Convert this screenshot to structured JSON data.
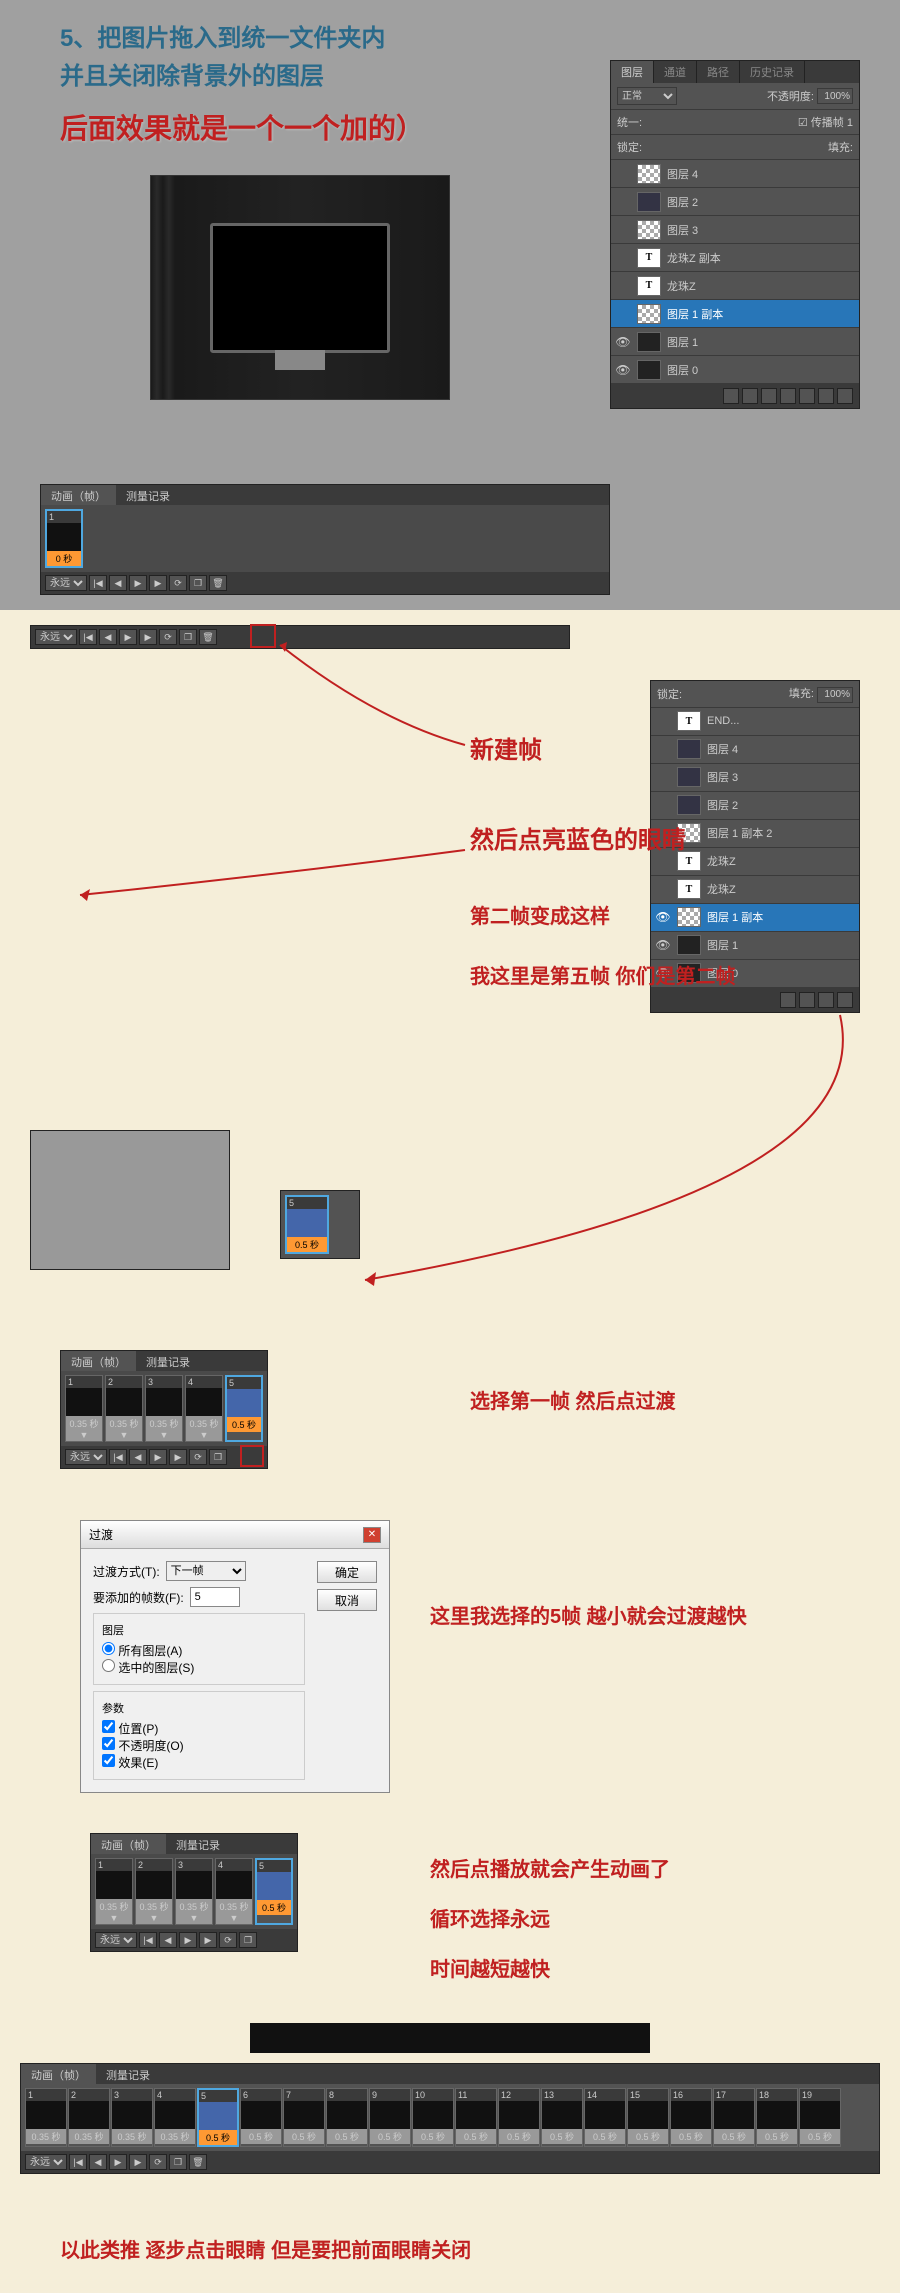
{
  "top": {
    "line1": "5、把图片拖入到统一文件夹内",
    "line2": "并且关闭除背景外的图层",
    "line3": "后面效果就是一个一个加的）"
  },
  "layersPanel1": {
    "tabs": [
      "图层",
      "通道",
      "路径",
      "历史记录"
    ],
    "mode": "正常",
    "opacityLabel": "不透明度:",
    "opacity": "100%",
    "lockLabel": "统一:",
    "fillLabel": "传播帧 1",
    "lockRow": "锁定:",
    "fillPct": "填充:",
    "layers": [
      {
        "eye": false,
        "thumb": "checker",
        "name": "图层 4"
      },
      {
        "eye": false,
        "thumb": "img",
        "name": "图层 2"
      },
      {
        "eye": false,
        "thumb": "checker",
        "name": "图层 3"
      },
      {
        "eye": false,
        "thumb": "text",
        "t": "T",
        "name": "龙珠Z 副本"
      },
      {
        "eye": false,
        "thumb": "text",
        "t": "T",
        "name": "龙珠Z"
      },
      {
        "eye": false,
        "thumb": "checker",
        "name": "图层 1 副本",
        "selected": true
      },
      {
        "eye": true,
        "thumb": "dark",
        "name": "图层 1"
      },
      {
        "eye": true,
        "thumb": "dark",
        "name": "图层 0"
      }
    ]
  },
  "timeline1": {
    "tabs": [
      "动画（帧）",
      "测量记录"
    ],
    "loop": "永远",
    "frame": {
      "num": "1",
      "time": "0 秒"
    }
  },
  "layersPanel2": {
    "lockLabel": "锁定:",
    "fillLabel": "填充:",
    "fillValue": "100%",
    "layers": [
      {
        "eye": false,
        "thumb": "text",
        "t": "T",
        "name": "END..."
      },
      {
        "eye": false,
        "thumb": "img",
        "name": "图层 4"
      },
      {
        "eye": false,
        "thumb": "img",
        "name": "图层 3"
      },
      {
        "eye": false,
        "thumb": "img",
        "name": "图层 2"
      },
      {
        "eye": false,
        "thumb": "checker",
        "name": "图层 1 副本 2"
      },
      {
        "eye": false,
        "thumb": "text",
        "t": "T",
        "name": "龙珠Z"
      },
      {
        "eye": false,
        "thumb": "text",
        "t": "T",
        "name": "龙珠Z"
      },
      {
        "eye": true,
        "thumb": "checker",
        "name": "图层 1 副本",
        "selected": true
      },
      {
        "eye": true,
        "thumb": "dark",
        "name": "图层 1"
      },
      {
        "eye": true,
        "thumb": "dark",
        "name": "图层 0"
      }
    ]
  },
  "annotations": {
    "a1": "新建帧",
    "a2": "然后点亮蓝色的眼睛",
    "a3": "第二帧变成这样",
    "a4": "我这里是第五帧 你们是第二帧",
    "a5": "选择第一帧  然后点过渡",
    "a6": "这里我选择的5帧   越小就会过渡越快",
    "a7": "然后点播放就会产生动画了",
    "a8": "循环选择永远",
    "a9": "时间越短越快",
    "final": "以此类推 逐步点击眼睛 但是要把前面眼睛关闭"
  },
  "snippet5": {
    "num": "5",
    "time": "0.5 秒"
  },
  "timeline5": {
    "tabs": [
      "动画（帧）",
      "测量记录"
    ],
    "loop": "永远",
    "frames": [
      {
        "num": "1",
        "time": "0.35 秒▼"
      },
      {
        "num": "2",
        "time": "0.35 秒▼"
      },
      {
        "num": "3",
        "time": "0.35 秒▼"
      },
      {
        "num": "4",
        "time": "0.35 秒▼"
      },
      {
        "num": "5",
        "time": "0.5 秒",
        "selected": true
      }
    ]
  },
  "dialog": {
    "title": "过渡",
    "methodLabel": "过渡方式(T):",
    "methodValue": "下一帧",
    "framesLabel": "要添加的帧数(F):",
    "framesValue": "5",
    "ok": "确定",
    "cancel": "取消",
    "layersTitle": "图层",
    "radioAll": "所有图层(A)",
    "radioSel": "选中的图层(S)",
    "paramsTitle": "参数",
    "chkPos": "位置(P)",
    "chkOpacity": "不透明度(O)",
    "chkEffect": "效果(E)"
  },
  "timeline6": {
    "tabs": [
      "动画（帧）",
      "测量记录"
    ],
    "loop": "永远",
    "frames": [
      {
        "num": "1",
        "time": "0.35 秒▼"
      },
      {
        "num": "2",
        "time": "0.35 秒▼"
      },
      {
        "num": "3",
        "time": "0.35 秒▼"
      },
      {
        "num": "4",
        "time": "0.35 秒▼"
      },
      {
        "num": "5",
        "time": "0.5 秒",
        "selected": true
      }
    ]
  },
  "wideTimeline": {
    "tabs": [
      "动画（帧）",
      "测量记录"
    ],
    "loop": "永远",
    "frames": [
      {
        "num": "1",
        "time": "0.35 秒"
      },
      {
        "num": "2",
        "time": "0.35 秒"
      },
      {
        "num": "3",
        "time": "0.35 秒"
      },
      {
        "num": "4",
        "time": "0.35 秒"
      },
      {
        "num": "5",
        "time": "0.5 秒",
        "selected": true
      },
      {
        "num": "6",
        "time": "0.5 秒"
      },
      {
        "num": "7",
        "time": "0.5 秒"
      },
      {
        "num": "8",
        "time": "0.5 秒"
      },
      {
        "num": "9",
        "time": "0.5 秒"
      },
      {
        "num": "10",
        "time": "0.5 秒"
      },
      {
        "num": "11",
        "time": "0.5 秒"
      },
      {
        "num": "12",
        "time": "0.5 秒"
      },
      {
        "num": "13",
        "time": "0.5 秒"
      },
      {
        "num": "14",
        "time": "0.5 秒"
      },
      {
        "num": "15",
        "time": "0.5 秒"
      },
      {
        "num": "16",
        "time": "0.5 秒"
      },
      {
        "num": "17",
        "time": "0.5 秒"
      },
      {
        "num": "18",
        "time": "0.5 秒"
      },
      {
        "num": "19",
        "time": "0.5 秒"
      }
    ]
  }
}
